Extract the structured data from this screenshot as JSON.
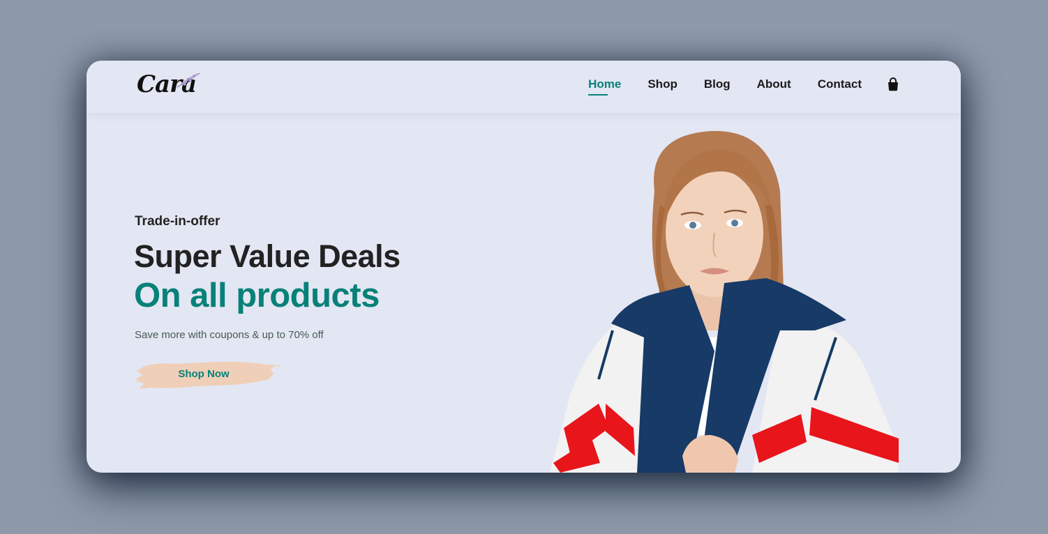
{
  "brand": {
    "logo_text": "Cara"
  },
  "nav": {
    "items": [
      {
        "label": "Home",
        "active": true
      },
      {
        "label": "Shop",
        "active": false
      },
      {
        "label": "Blog",
        "active": false
      },
      {
        "label": "About",
        "active": false
      },
      {
        "label": "Contact",
        "active": false
      }
    ],
    "cart_icon": "shopping-bag-icon"
  },
  "hero": {
    "eyebrow": "Trade-in-offer",
    "headline": "Super Value Deals",
    "highlight": "On all products",
    "subtext": "Save more with coupons & up to 70% off",
    "cta_label": "Shop Now"
  },
  "colors": {
    "accent": "#088178",
    "background": "#e3e6f3",
    "cta_brush": "#efcfb8",
    "text_dark": "#222222"
  }
}
